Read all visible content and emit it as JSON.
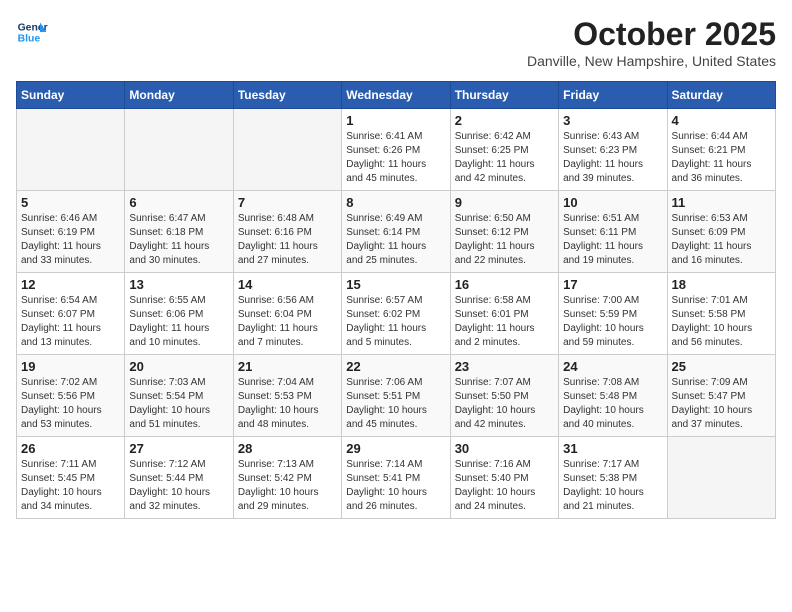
{
  "header": {
    "logo_line1": "General",
    "logo_line2": "Blue",
    "month": "October 2025",
    "location": "Danville, New Hampshire, United States"
  },
  "days_of_week": [
    "Sunday",
    "Monday",
    "Tuesday",
    "Wednesday",
    "Thursday",
    "Friday",
    "Saturday"
  ],
  "weeks": [
    [
      {
        "day": "",
        "content": ""
      },
      {
        "day": "",
        "content": ""
      },
      {
        "day": "",
        "content": ""
      },
      {
        "day": "1",
        "content": "Sunrise: 6:41 AM\nSunset: 6:26 PM\nDaylight: 11 hours\nand 45 minutes."
      },
      {
        "day": "2",
        "content": "Sunrise: 6:42 AM\nSunset: 6:25 PM\nDaylight: 11 hours\nand 42 minutes."
      },
      {
        "day": "3",
        "content": "Sunrise: 6:43 AM\nSunset: 6:23 PM\nDaylight: 11 hours\nand 39 minutes."
      },
      {
        "day": "4",
        "content": "Sunrise: 6:44 AM\nSunset: 6:21 PM\nDaylight: 11 hours\nand 36 minutes."
      }
    ],
    [
      {
        "day": "5",
        "content": "Sunrise: 6:46 AM\nSunset: 6:19 PM\nDaylight: 11 hours\nand 33 minutes."
      },
      {
        "day": "6",
        "content": "Sunrise: 6:47 AM\nSunset: 6:18 PM\nDaylight: 11 hours\nand 30 minutes."
      },
      {
        "day": "7",
        "content": "Sunrise: 6:48 AM\nSunset: 6:16 PM\nDaylight: 11 hours\nand 27 minutes."
      },
      {
        "day": "8",
        "content": "Sunrise: 6:49 AM\nSunset: 6:14 PM\nDaylight: 11 hours\nand 25 minutes."
      },
      {
        "day": "9",
        "content": "Sunrise: 6:50 AM\nSunset: 6:12 PM\nDaylight: 11 hours\nand 22 minutes."
      },
      {
        "day": "10",
        "content": "Sunrise: 6:51 AM\nSunset: 6:11 PM\nDaylight: 11 hours\nand 19 minutes."
      },
      {
        "day": "11",
        "content": "Sunrise: 6:53 AM\nSunset: 6:09 PM\nDaylight: 11 hours\nand 16 minutes."
      }
    ],
    [
      {
        "day": "12",
        "content": "Sunrise: 6:54 AM\nSunset: 6:07 PM\nDaylight: 11 hours\nand 13 minutes."
      },
      {
        "day": "13",
        "content": "Sunrise: 6:55 AM\nSunset: 6:06 PM\nDaylight: 11 hours\nand 10 minutes."
      },
      {
        "day": "14",
        "content": "Sunrise: 6:56 AM\nSunset: 6:04 PM\nDaylight: 11 hours\nand 7 minutes."
      },
      {
        "day": "15",
        "content": "Sunrise: 6:57 AM\nSunset: 6:02 PM\nDaylight: 11 hours\nand 5 minutes."
      },
      {
        "day": "16",
        "content": "Sunrise: 6:58 AM\nSunset: 6:01 PM\nDaylight: 11 hours\nand 2 minutes."
      },
      {
        "day": "17",
        "content": "Sunrise: 7:00 AM\nSunset: 5:59 PM\nDaylight: 10 hours\nand 59 minutes."
      },
      {
        "day": "18",
        "content": "Sunrise: 7:01 AM\nSunset: 5:58 PM\nDaylight: 10 hours\nand 56 minutes."
      }
    ],
    [
      {
        "day": "19",
        "content": "Sunrise: 7:02 AM\nSunset: 5:56 PM\nDaylight: 10 hours\nand 53 minutes."
      },
      {
        "day": "20",
        "content": "Sunrise: 7:03 AM\nSunset: 5:54 PM\nDaylight: 10 hours\nand 51 minutes."
      },
      {
        "day": "21",
        "content": "Sunrise: 7:04 AM\nSunset: 5:53 PM\nDaylight: 10 hours\nand 48 minutes."
      },
      {
        "day": "22",
        "content": "Sunrise: 7:06 AM\nSunset: 5:51 PM\nDaylight: 10 hours\nand 45 minutes."
      },
      {
        "day": "23",
        "content": "Sunrise: 7:07 AM\nSunset: 5:50 PM\nDaylight: 10 hours\nand 42 minutes."
      },
      {
        "day": "24",
        "content": "Sunrise: 7:08 AM\nSunset: 5:48 PM\nDaylight: 10 hours\nand 40 minutes."
      },
      {
        "day": "25",
        "content": "Sunrise: 7:09 AM\nSunset: 5:47 PM\nDaylight: 10 hours\nand 37 minutes."
      }
    ],
    [
      {
        "day": "26",
        "content": "Sunrise: 7:11 AM\nSunset: 5:45 PM\nDaylight: 10 hours\nand 34 minutes."
      },
      {
        "day": "27",
        "content": "Sunrise: 7:12 AM\nSunset: 5:44 PM\nDaylight: 10 hours\nand 32 minutes."
      },
      {
        "day": "28",
        "content": "Sunrise: 7:13 AM\nSunset: 5:42 PM\nDaylight: 10 hours\nand 29 minutes."
      },
      {
        "day": "29",
        "content": "Sunrise: 7:14 AM\nSunset: 5:41 PM\nDaylight: 10 hours\nand 26 minutes."
      },
      {
        "day": "30",
        "content": "Sunrise: 7:16 AM\nSunset: 5:40 PM\nDaylight: 10 hours\nand 24 minutes."
      },
      {
        "day": "31",
        "content": "Sunrise: 7:17 AM\nSunset: 5:38 PM\nDaylight: 10 hours\nand 21 minutes."
      },
      {
        "day": "",
        "content": ""
      }
    ]
  ]
}
